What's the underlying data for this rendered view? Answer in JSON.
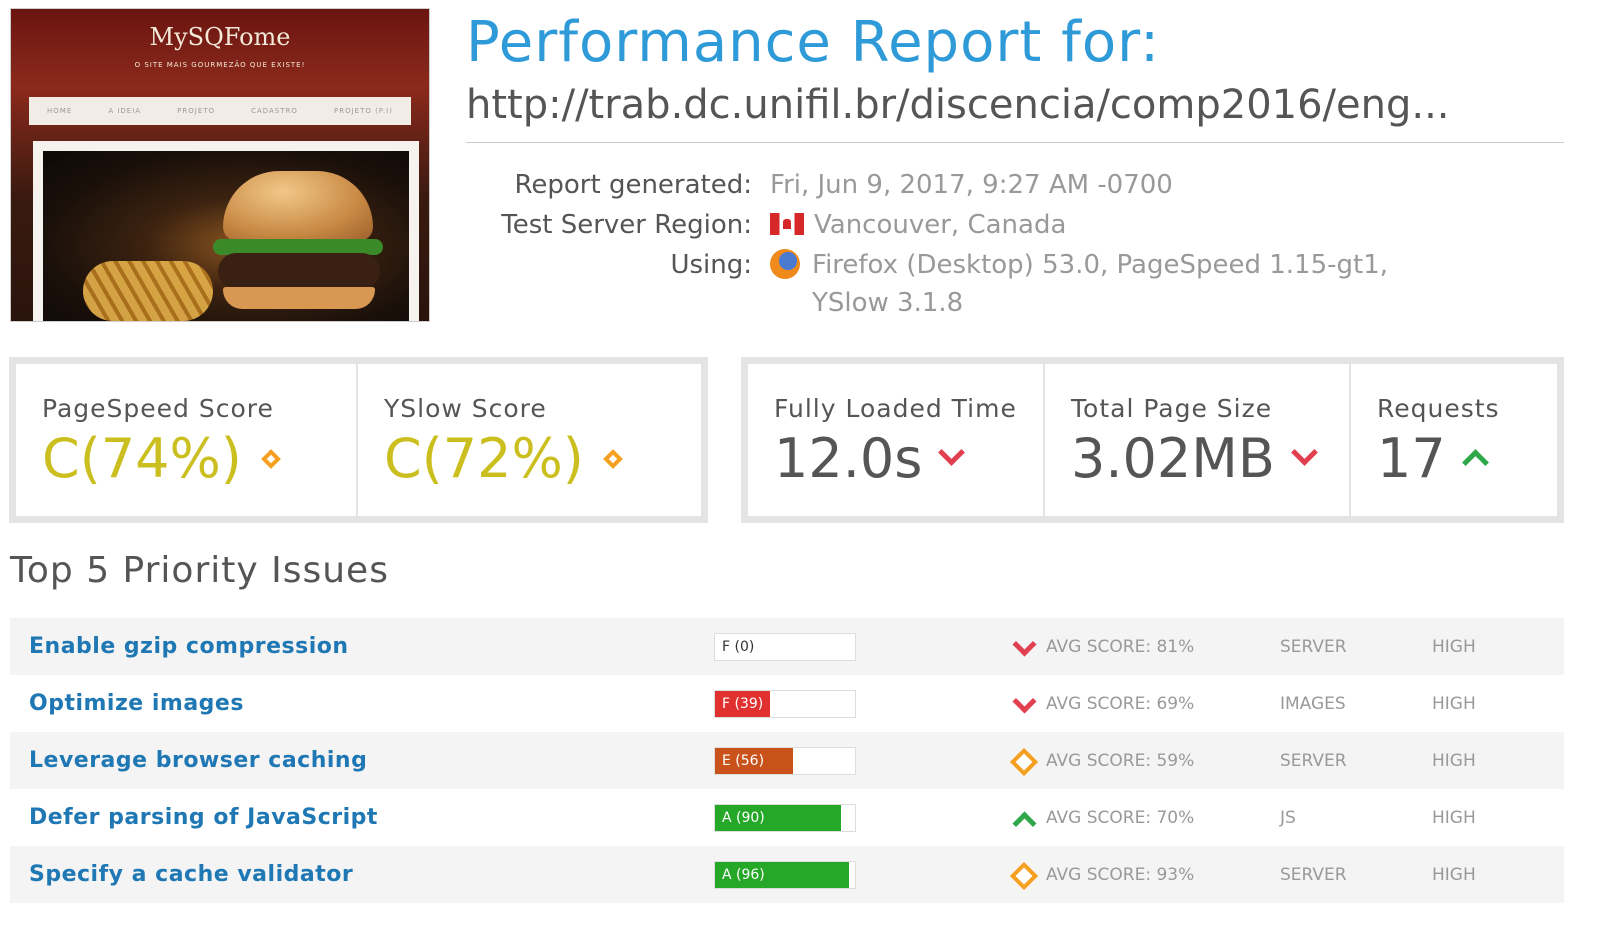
{
  "thumbnail": {
    "brand": "MySQFome",
    "tagline": "O SITE MAIS GOURMEZÃO QUE EXISTE!",
    "nav": [
      "HOME",
      "A IDEIA",
      "PROJETO",
      "CADASTRO",
      "PROJETO (P.I)"
    ]
  },
  "header": {
    "title": "Performance Report for:",
    "url": "http://trab.dc.unifil.br/discencia/comp2016/eng..."
  },
  "meta": {
    "generated_label": "Report generated:",
    "generated_value": "Fri, Jun 9, 2017, 9:27 AM -0700",
    "region_label": "Test Server Region:",
    "region_value": "Vancouver, Canada",
    "using_label": "Using:",
    "using_value_line1": "Firefox (Desktop) 53.0, PageSpeed 1.15-gt1,",
    "using_value_line2": "YSlow 3.1.8",
    "region_icon": "canada-flag-icon",
    "browser_icon": "firefox-icon"
  },
  "scores": {
    "pagespeed_label": "PageSpeed Score",
    "pagespeed_grade": "C",
    "pagespeed_pct": "(74%)",
    "yslow_label": "YSlow Score",
    "yslow_grade": "C",
    "yslow_pct": "(72%)",
    "grade_color": "#cbbf20"
  },
  "metrics": {
    "loaded_label": "Fully Loaded Time",
    "loaded_value": "12.0s",
    "size_label": "Total Page Size",
    "size_value": "3.02MB",
    "requests_label": "Requests",
    "requests_value": "17"
  },
  "issues_title": "Top 5 Priority Issues",
  "issues": [
    {
      "name": "Enable gzip compression",
      "grade": "F (0)",
      "score": 0,
      "color": "#e03030",
      "trend": "down",
      "avg": "AVG SCORE: 81%",
      "type": "SERVER",
      "priority": "HIGH"
    },
    {
      "name": "Optimize images",
      "grade": "F (39)",
      "score": 39,
      "color": "#e03030",
      "trend": "down",
      "avg": "AVG SCORE: 69%",
      "type": "IMAGES",
      "priority": "HIGH"
    },
    {
      "name": "Leverage browser caching",
      "grade": "E (56)",
      "score": 56,
      "color": "#c9521a",
      "trend": "neutral",
      "avg": "AVG SCORE: 59%",
      "type": "SERVER",
      "priority": "HIGH"
    },
    {
      "name": "Defer parsing of JavaScript",
      "grade": "A (90)",
      "score": 90,
      "color": "#25a828",
      "trend": "up",
      "avg": "AVG SCORE: 70%",
      "type": "JS",
      "priority": "HIGH"
    },
    {
      "name": "Specify a cache validator",
      "grade": "A (96)",
      "score": 96,
      "color": "#25a828",
      "trend": "neutral",
      "avg": "AVG SCORE: 93%",
      "type": "SERVER",
      "priority": "HIGH"
    }
  ]
}
